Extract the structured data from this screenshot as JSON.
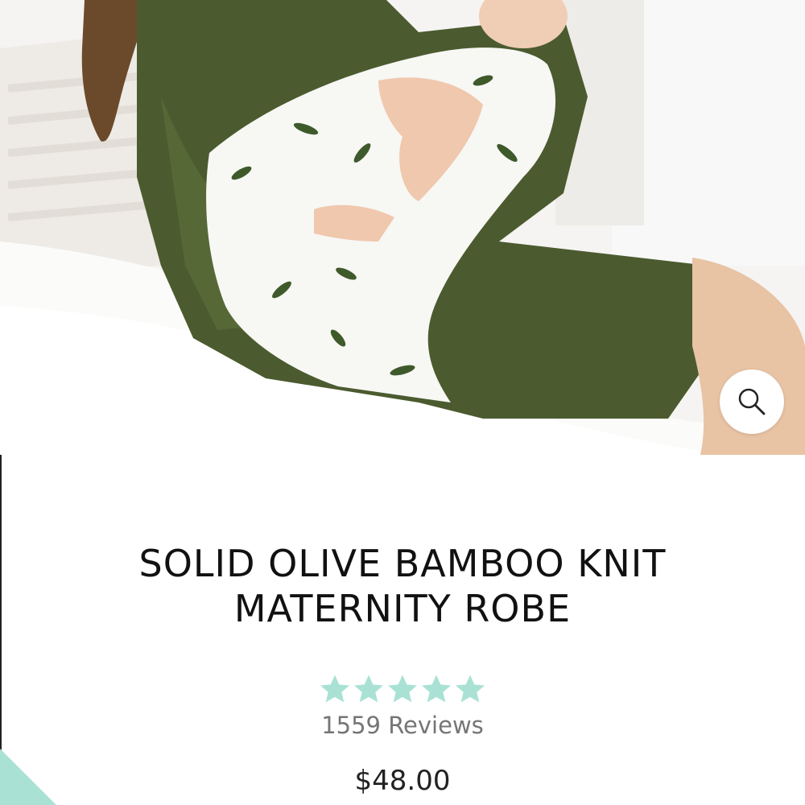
{
  "product": {
    "image_alt": "Woman in olive robe holding a swaddled newborn",
    "title": "SOLID OLIVE BAMBOO KNIT MATERNITY ROBE",
    "rating": 5,
    "rating_max": 5,
    "reviews_label": "1559 Reviews",
    "price": "$48.00"
  },
  "icons": {
    "zoom": "magnifier-icon",
    "star": "star-icon"
  },
  "colors": {
    "star": "#a9e2d4",
    "accent": "#a9e2d4",
    "robe": "#4a5a2e",
    "title": "#111111",
    "reviews": "#757575"
  }
}
